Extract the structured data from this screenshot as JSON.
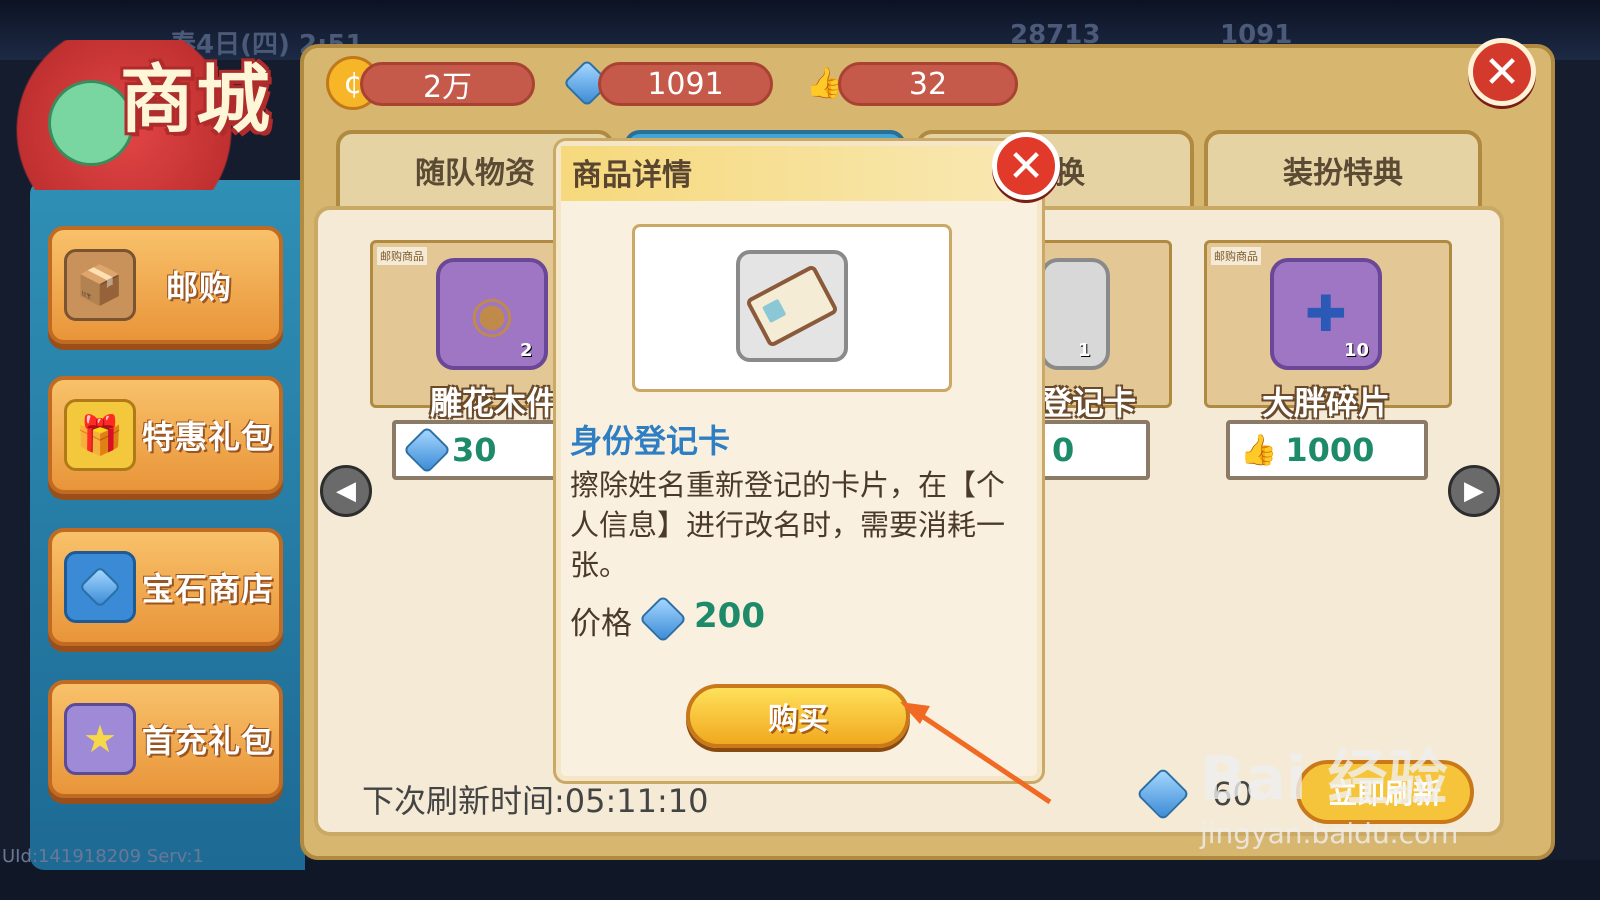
{
  "shop": {
    "logo_title": "商城"
  },
  "background": {
    "date_text": "春4日(四) 2:51",
    "coins_bg": "28713",
    "gems_bg": "1091"
  },
  "currencies": {
    "coins": "2万",
    "gems": "1091",
    "likes": "32"
  },
  "sidebar": {
    "items": [
      {
        "label": "邮购",
        "icon": "box-icon"
      },
      {
        "label": "特惠礼包",
        "icon": "gift-icon"
      },
      {
        "label": "宝石商店",
        "icon": "gem-icon"
      },
      {
        "label": "首充礼包",
        "icon": "card-icon"
      }
    ]
  },
  "tabs": [
    {
      "label": "随队物资"
    },
    {
      "label": ""
    },
    {
      "label": "兑换"
    },
    {
      "label": "装扮特典"
    }
  ],
  "goods": [
    {
      "tag": "邮购商品",
      "name": "雕花木件",
      "qty": "2",
      "price": "30",
      "currency": "gem"
    },
    {
      "tag": "邮购商品",
      "name": "登记卡",
      "qty": "1",
      "price": "0",
      "currency": "gem"
    },
    {
      "tag": "邮购商品",
      "name": "大胖碎片",
      "qty": "10",
      "price": "1000",
      "currency": "like"
    }
  ],
  "refresh": {
    "text": "下次刷新时间:05:11:10",
    "cost": "60",
    "button_label": "立即刷新"
  },
  "modal": {
    "title": "商品详情",
    "item_name": "身份登记卡",
    "description": "擦除姓名重新登记的卡片，在【个人信息】进行改名时，需要消耗一张。",
    "price_label": "价格",
    "price_value": "200",
    "buy_label": "购买"
  },
  "watermark": {
    "main": "Bai 经验",
    "sub": "jingyan.baidu.com"
  },
  "footer": {
    "uid": "UId:141918209 Serv:1"
  },
  "colors": {
    "accent_red": "#e23a2a",
    "price_green": "#1d8a6a",
    "title_blue": "#2e7ec4",
    "buy_yellow": "#f6c43a"
  }
}
